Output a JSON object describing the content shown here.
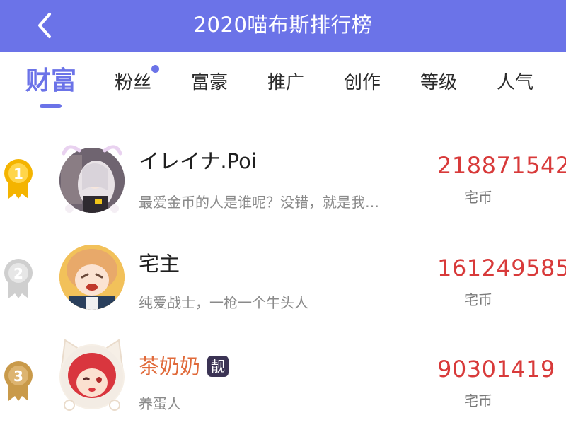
{
  "header": {
    "title": "2020喵布斯排行榜",
    "back_icon": "chevron-left-icon"
  },
  "tabs": [
    {
      "label": "财富",
      "active": true
    },
    {
      "label": "粉丝",
      "active": false,
      "has_dot": true
    },
    {
      "label": "富豪",
      "active": false
    },
    {
      "label": "推广",
      "active": false
    },
    {
      "label": "创作",
      "active": false
    },
    {
      "label": "等级",
      "active": false
    },
    {
      "label": "人气",
      "active": false
    }
  ],
  "ranking": [
    {
      "rank": "1",
      "medal": "gold-medal-icon",
      "name": "イレイナ.Poi",
      "signature": "最爱金币的人是谁呢？没错，就是我…",
      "score": "218871542",
      "unit": "宅币"
    },
    {
      "rank": "2",
      "medal": "silver-medal-icon",
      "name": "宅主",
      "signature": "纯爱战士，一枪一个牛头人",
      "score": "161249585",
      "unit": "宅币"
    },
    {
      "rank": "3",
      "medal": "bronze-medal-icon",
      "name": "茶奶奶",
      "badge": "靓",
      "signature": "养蛋人",
      "score": "90301419",
      "unit": "宅币"
    }
  ],
  "colors": {
    "accent": "#6b73e8",
    "score": "#d83a3a",
    "vip_name": "#e06a3a",
    "gold": "#f4b400",
    "silver": "#cfcfcf",
    "bronze": "#c99a4a"
  }
}
